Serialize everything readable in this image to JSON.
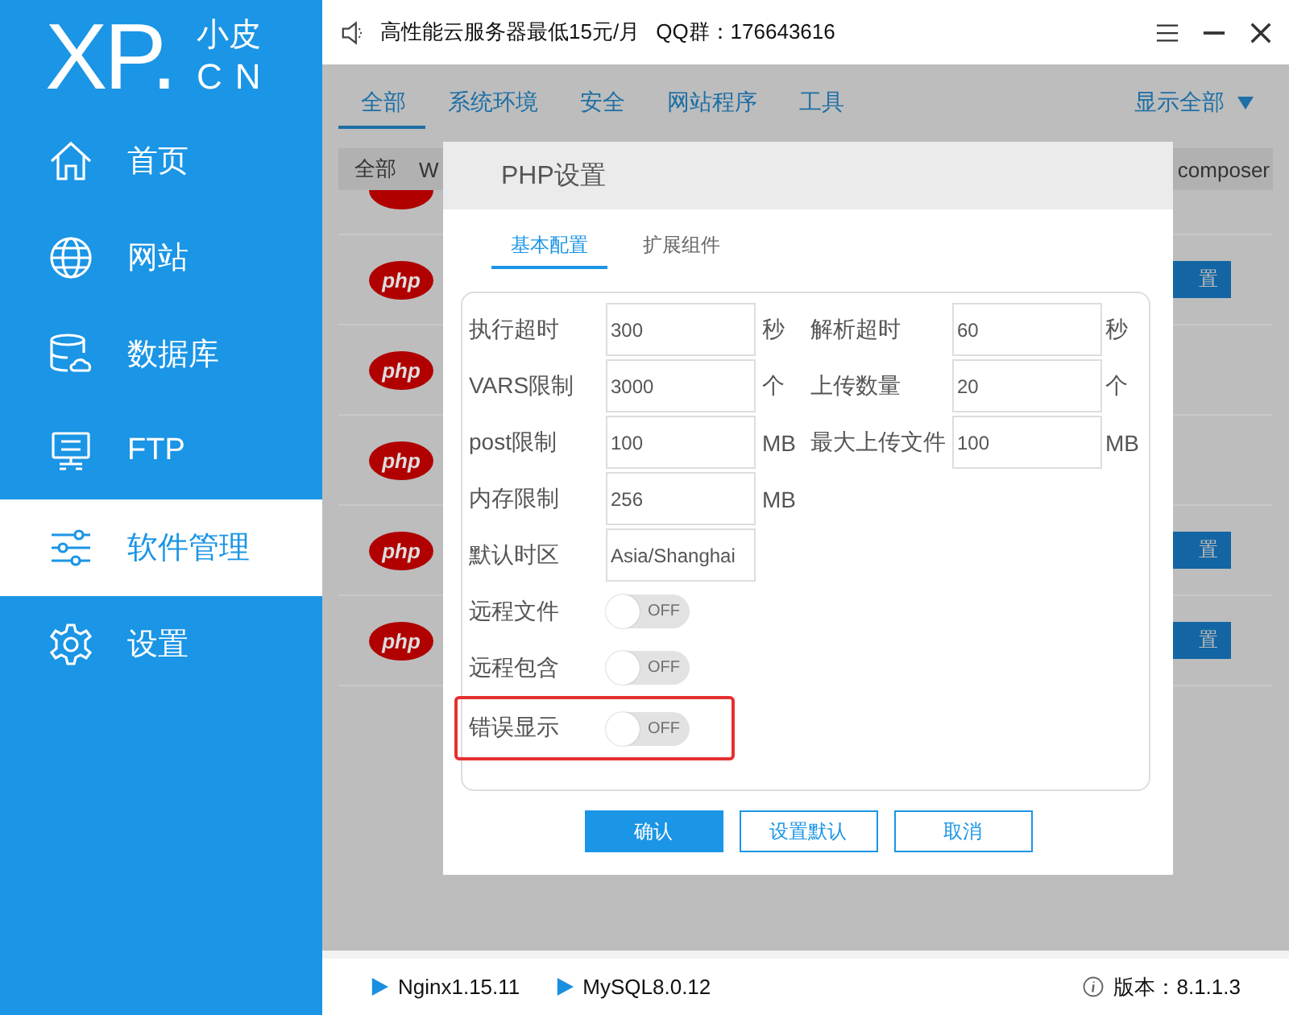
{
  "title_bar": {
    "notice": "高性能云服务器最低15元/月",
    "qq": "QQ群：176643616"
  },
  "logo": {
    "mark": "XP.",
    "name": "小皮",
    "domain": "CN"
  },
  "sidebar": {
    "items": [
      {
        "label": "首页",
        "selected": false
      },
      {
        "label": "网站",
        "selected": false
      },
      {
        "label": "数据库",
        "selected": false
      },
      {
        "label": "FTP",
        "selected": false
      },
      {
        "label": "软件管理",
        "selected": true
      },
      {
        "label": "设置",
        "selected": false
      }
    ]
  },
  "category_tabs": [
    {
      "label": "全部",
      "selected": true
    },
    {
      "label": "系统环境",
      "selected": false
    },
    {
      "label": "安全",
      "selected": false
    },
    {
      "label": "网站程序",
      "selected": false
    },
    {
      "label": "工具",
      "selected": false
    }
  ],
  "show_all": "显示全部",
  "table": {
    "columns": [
      "全部",
      "W",
      "composer"
    ],
    "rows": [
      {
        "kind": "php"
      },
      {
        "kind": "php",
        "logo": "php",
        "button": "置"
      },
      {
        "kind": "php",
        "logo": "php"
      },
      {
        "kind": "php",
        "logo": "php"
      },
      {
        "kind": "php",
        "logo": "php",
        "button": "置"
      },
      {
        "kind": "php",
        "logo": "php",
        "button": "置"
      }
    ]
  },
  "dialog": {
    "title": "PHP设置",
    "tabs": [
      {
        "label": "基本配置",
        "selected": true
      },
      {
        "label": "扩展组件",
        "selected": false
      }
    ],
    "rows": [
      {
        "kind": "inputs",
        "cells": [
          {
            "label": "执行超时",
            "value": "300",
            "unit": "秒"
          },
          {
            "label": "解析超时",
            "value": "60",
            "unit": "秒"
          }
        ]
      },
      {
        "kind": "inputs",
        "cells": [
          {
            "label": "VARS限制",
            "value": "3000",
            "unit": "个"
          },
          {
            "label": "上传数量",
            "value": "20",
            "unit": "个"
          }
        ]
      },
      {
        "kind": "inputs",
        "cells": [
          {
            "label": "post限制",
            "value": "100",
            "unit": "MB"
          },
          {
            "label": "最大上传文件",
            "value": "100",
            "unit": "MB"
          }
        ]
      },
      {
        "kind": "inputs",
        "cells": [
          {
            "label": "内存限制",
            "value": "256",
            "unit": "MB"
          }
        ]
      },
      {
        "kind": "inputs",
        "cells": [
          {
            "label": "默认时区",
            "value": "Asia/Shanghai"
          }
        ]
      },
      {
        "kind": "toggle",
        "label": "远程文件",
        "on": false,
        "text": "OFF",
        "highlighted": false
      },
      {
        "kind": "toggle",
        "label": "远程包含",
        "on": false,
        "text": "OFF",
        "highlighted": false
      },
      {
        "kind": "toggle",
        "label": "错误显示",
        "on": false,
        "text": "OFF",
        "highlighted": true
      }
    ],
    "buttons": [
      {
        "label": "确认",
        "primary": true
      },
      {
        "label": "设置默认",
        "primary": false
      },
      {
        "label": "取消",
        "primary": false
      }
    ]
  },
  "status_bar": {
    "services": [
      "Nginx1.15.11",
      "MySQL8.0.12"
    ],
    "version": "版本：8.1.1.3"
  }
}
